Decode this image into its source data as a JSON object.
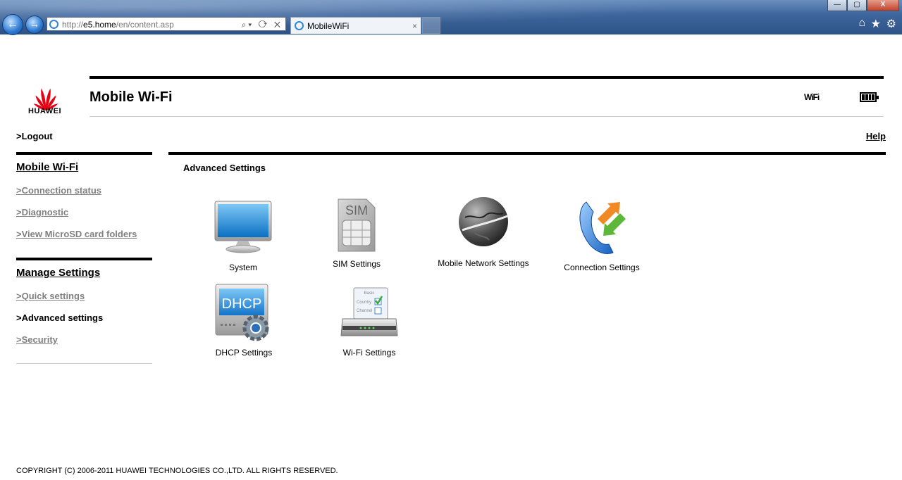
{
  "browser": {
    "url_prefix": "http://",
    "url_host": "e5.home",
    "url_path": "/en/content.asp",
    "tab_title": "MobileWiFi",
    "tab_close": "×",
    "address_tools": "⌕▾ ⟳ ✕",
    "back": "←",
    "forward": "→",
    "win_min": "—",
    "win_max": "▢",
    "win_close": "X",
    "home": "⌂",
    "star": "★",
    "gear": "⚙"
  },
  "header": {
    "brand": "HUAWEI",
    "title": "Mobile Wi-Fi",
    "wifi_indicator": "WiFi"
  },
  "nav": {
    "logout": ">Logout",
    "help": "Help"
  },
  "sidebar": {
    "mobile_wifi_title": "Mobile Wi-Fi",
    "mobile_wifi_items": [
      {
        "label": ">Connection status"
      },
      {
        "label": ">Diagnostic"
      },
      {
        "label": ">View MicroSD card folders"
      }
    ],
    "manage_title": "Manage Settings",
    "manage_items": [
      {
        "label": ">Quick settings"
      },
      {
        "label": ">Advanced settings"
      },
      {
        "label": ">Security"
      }
    ]
  },
  "main": {
    "title": "Advanced Settings",
    "tiles": [
      {
        "label": "System",
        "icon": "monitor-icon"
      },
      {
        "label": "SIM Settings",
        "icon": "sim-card-icon",
        "icon_text": "SIM"
      },
      {
        "label": "Mobile Network Settings",
        "icon": "globe-icon"
      },
      {
        "label": "Connection Settings",
        "icon": "phone-arrows-icon"
      },
      {
        "label": "DHCP Settings",
        "icon": "dhcp-server-icon",
        "icon_text": "DHCP"
      },
      {
        "label": "Wi-Fi Settings",
        "icon": "router-icon",
        "icon_text_1": "Basic",
        "icon_text_2": "Country",
        "icon_text_3": "Channel"
      }
    ]
  },
  "footer": {
    "copyright": "COPYRIGHT (C) 2006-2011 HUAWEI TECHNOLOGIES CO.,LTD. ALL RIGHTS RESERVED."
  }
}
